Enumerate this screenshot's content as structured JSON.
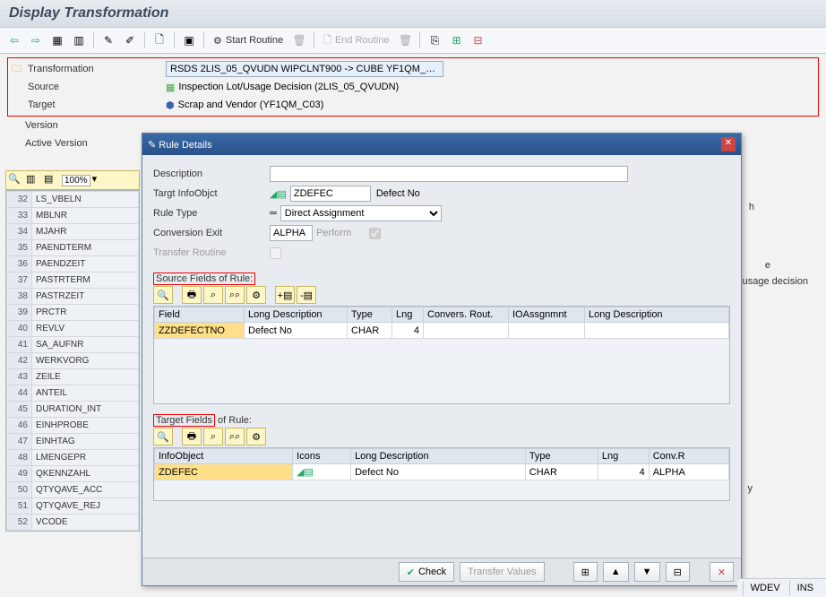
{
  "page_title": "Display Transformation",
  "toolbar": {
    "back": "⇦",
    "forward": "⇨",
    "start_routine": "Start Routine",
    "end_routine": "End Routine"
  },
  "header": {
    "transformation_label": "Transformation",
    "transformation_value": "RSDS 2LIS_05_QVUDN WIPCLNT900 -> CUBE YF1QM_…",
    "source_label": "Source",
    "source_value": "Inspection Lot/Usage Decision (2LIS_05_QVUDN)",
    "target_label": "Target",
    "target_value": "Scrap and Vendor (YF1QM_C03)",
    "version_label": "Version",
    "active_version_label": "Active Version"
  },
  "left_table": {
    "zoom": "100%",
    "rows": [
      {
        "n": "32",
        "f": "LS_VBELN"
      },
      {
        "n": "33",
        "f": "MBLNR"
      },
      {
        "n": "34",
        "f": "MJAHR"
      },
      {
        "n": "35",
        "f": "PAENDTERM"
      },
      {
        "n": "36",
        "f": "PAENDZEIT"
      },
      {
        "n": "37",
        "f": "PASTRTERM"
      },
      {
        "n": "38",
        "f": "PASTRZEIT"
      },
      {
        "n": "39",
        "f": "PRCTR"
      },
      {
        "n": "40",
        "f": "REVLV"
      },
      {
        "n": "41",
        "f": "SA_AUFNR"
      },
      {
        "n": "42",
        "f": "WERKVORG"
      },
      {
        "n": "43",
        "f": "ZEILE"
      },
      {
        "n": "44",
        "f": "ANTEIL"
      },
      {
        "n": "45",
        "f": "DURATION_INT"
      },
      {
        "n": "46",
        "f": "EINHPROBE"
      },
      {
        "n": "47",
        "f": "EINHTAG"
      },
      {
        "n": "48",
        "f": "LMENGEPR"
      },
      {
        "n": "49",
        "f": "QKENNZAHL"
      },
      {
        "n": "50",
        "f": "QTYQAVE_ACC"
      },
      {
        "n": "51",
        "f": "QTYQAVE_REJ"
      },
      {
        "n": "52",
        "f": "VCODE"
      }
    ]
  },
  "right_fragments": {
    "h": "h",
    "e": "e",
    "usage": "usage decision",
    "y": "y"
  },
  "dialog": {
    "title": "Rule Details",
    "description_label": "Description",
    "description_value": "",
    "target_io_label": "Targt InfoObjct",
    "target_io_value": "ZDEFEC",
    "target_io_desc": "Defect No",
    "rule_type_label": "Rule Type",
    "rule_type_value": "Direct Assignment",
    "conv_exit_label": "Conversion Exit",
    "conv_exit_value": "ALPHA",
    "conv_exit_text": "Perform",
    "transfer_routine_label": "Transfer Routine",
    "source_fields_title": "Source Fields of Rule:",
    "source_headers": [
      "Field",
      "Long Description",
      "Type",
      "Lng",
      "Convers. Rout.",
      "IOAssgnmnt",
      "Long Description"
    ],
    "source_row": {
      "field": "ZZDEFECTNO",
      "desc": "Defect No",
      "type": "CHAR",
      "lng": "4",
      "conv": "",
      "io": "",
      "ldesc": ""
    },
    "target_fields_title": "Target Fields of Rule:",
    "target_headers": [
      "InfoObject",
      "Icons",
      "Long Description",
      "Type",
      "Lng",
      "Conv.R"
    ],
    "target_row": {
      "io": "ZDEFEC",
      "desc": "Defect No",
      "type": "CHAR",
      "lng": "4",
      "conv": "ALPHA"
    },
    "check_label": "Check",
    "transfer_values_label": "Transfer Values"
  },
  "statusbar": {
    "sys": "WDEV",
    "mode": "INS"
  }
}
